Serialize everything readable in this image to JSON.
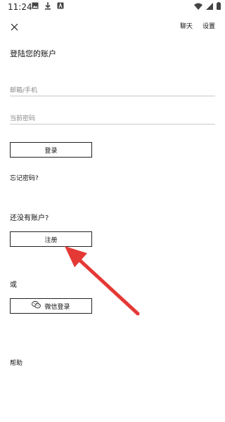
{
  "status_bar": {
    "time": "11:24"
  },
  "top_bar": {
    "chat_label": "聊天",
    "settings_label": "设置"
  },
  "login": {
    "title": "登陆您的账户",
    "email_placeholder": "邮箱/手机",
    "password_placeholder": "当前密码",
    "login_button": "登录",
    "forgot_password": "忘记密码?"
  },
  "register": {
    "prompt": "还没有账户?",
    "button": "注册"
  },
  "alternative": {
    "or_label": "或",
    "wechat_button": "微信登录"
  },
  "help_link": "帮助",
  "colors": {
    "arrow": "#e53935",
    "border": "#222222",
    "divider": "#c8c8c8"
  }
}
